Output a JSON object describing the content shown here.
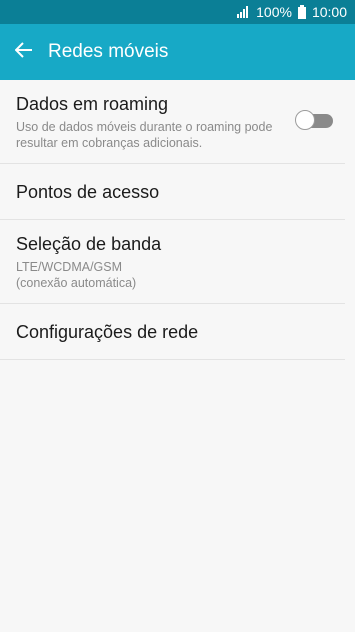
{
  "status": {
    "battery": "100%",
    "time": "10:00"
  },
  "header": {
    "title": "Redes móveis"
  },
  "items": [
    {
      "label": "Dados em roaming",
      "sub": "Uso de dados móveis durante o roaming pode resultar em cobranças adicionais.",
      "toggle_on": false
    },
    {
      "label": "Pontos de acesso"
    },
    {
      "label": "Seleção de banda",
      "sub1": "LTE/WCDMA/GSM",
      "sub2": "(conexão automática)"
    },
    {
      "label": "Configurações de rede"
    }
  ]
}
